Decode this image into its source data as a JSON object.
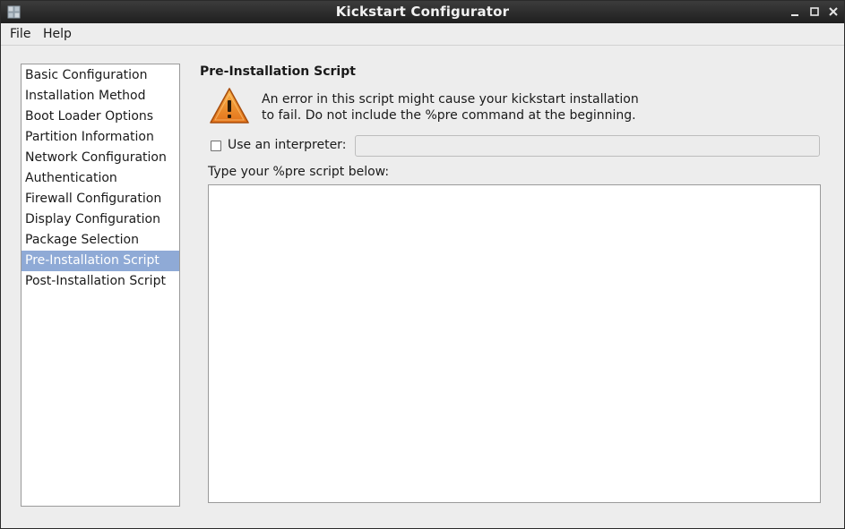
{
  "window": {
    "title": "Kickstart Configurator"
  },
  "menu": {
    "file": "File",
    "help": "Help"
  },
  "sidebar": {
    "items": [
      {
        "label": "Basic Configuration"
      },
      {
        "label": "Installation Method"
      },
      {
        "label": "Boot Loader Options"
      },
      {
        "label": "Partition Information"
      },
      {
        "label": "Network Configuration"
      },
      {
        "label": "Authentication"
      },
      {
        "label": "Firewall Configuration"
      },
      {
        "label": "Display Configuration"
      },
      {
        "label": "Package Selection"
      },
      {
        "label": "Pre-Installation Script"
      },
      {
        "label": "Post-Installation Script"
      }
    ],
    "selected": "Pre-Installation Script"
  },
  "main": {
    "title": "Pre-Installation Script",
    "warning_line1": "An error in this script might cause your kickstart installation",
    "warning_line2": "to fail. Do not include the %pre command at the beginning.",
    "interpreter_label": "Use an interpreter:",
    "interpreter_checked": false,
    "interpreter_value": "",
    "script_label": "Type your %pre script below:",
    "script_value": ""
  },
  "colors": {
    "selection": "#8faad6",
    "titlebar": "#2b2b2b",
    "warning": "#f08c1c"
  },
  "icons": {
    "app": "kickstart-app-icon",
    "warning": "warning-triangle-icon"
  }
}
